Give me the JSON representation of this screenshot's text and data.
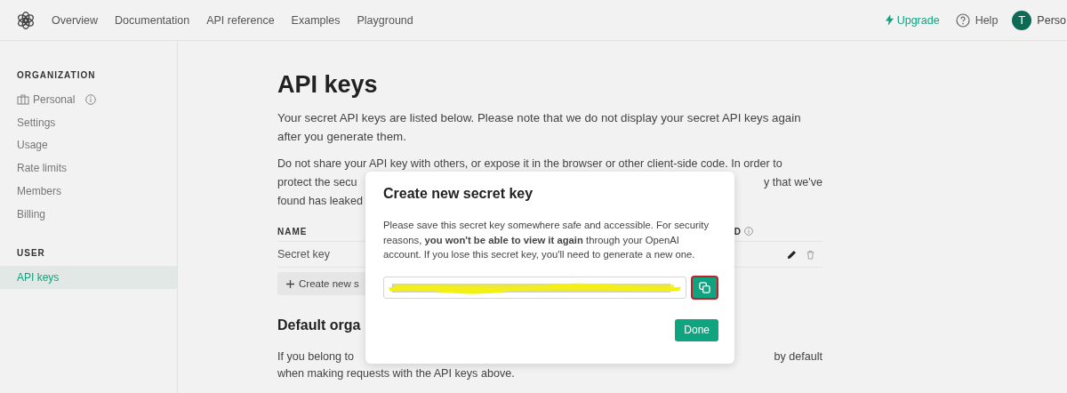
{
  "nav": {
    "links": [
      {
        "label": "Overview"
      },
      {
        "label": "Documentation"
      },
      {
        "label": "API reference"
      },
      {
        "label": "Examples"
      },
      {
        "label": "Playground"
      }
    ],
    "upgrade": "Upgrade",
    "help": "Help",
    "avatar": "T",
    "account": "Perso"
  },
  "sidebar": {
    "sections": [
      {
        "heading": "ORGANIZATION",
        "items": [
          {
            "label": "Personal",
            "kind": "org",
            "selected": false
          },
          {
            "label": "Settings",
            "kind": "link",
            "selected": false
          },
          {
            "label": "Usage",
            "kind": "link",
            "selected": false
          },
          {
            "label": "Rate limits",
            "kind": "link",
            "selected": false
          },
          {
            "label": "Members",
            "kind": "link",
            "selected": false
          },
          {
            "label": "Billing",
            "kind": "link",
            "selected": false
          }
        ]
      },
      {
        "heading": "USER",
        "items": [
          {
            "label": "API keys",
            "kind": "link",
            "selected": true
          }
        ]
      }
    ]
  },
  "page": {
    "title": "API keys",
    "intro": "Your secret API keys are listed below. Please note that we do not display your secret API keys again after you generate them.",
    "warning": {
      "line_1": "Do not share your API key with others, or expose it in the browser or other client-side code. In order to",
      "line_2_left": "protect the secu",
      "line_2_right": "y that we've",
      "line_3_left": "found has leaked"
    },
    "table": {
      "header_left": "NAME",
      "header_right": "D",
      "rows": [
        {
          "name": "Secret key"
        }
      ]
    },
    "create_button": "Create new s",
    "default_org": {
      "title": "Default orga",
      "line_1_left": "If you belong to",
      "line_1_right": "by default",
      "line_2": "when making requests with the API keys above."
    }
  },
  "modal": {
    "title": "Create new secret key",
    "message": "Please save this secret key somewhere safe and accessible. For security reasons, **you won't be able to view it again** through your OpenAI account. If you lose this secret key, you'll need to generate a new one.",
    "key_field": {
      "redacted": true
    },
    "copy_button": {
      "highlighted": true
    },
    "done": "Done"
  }
}
